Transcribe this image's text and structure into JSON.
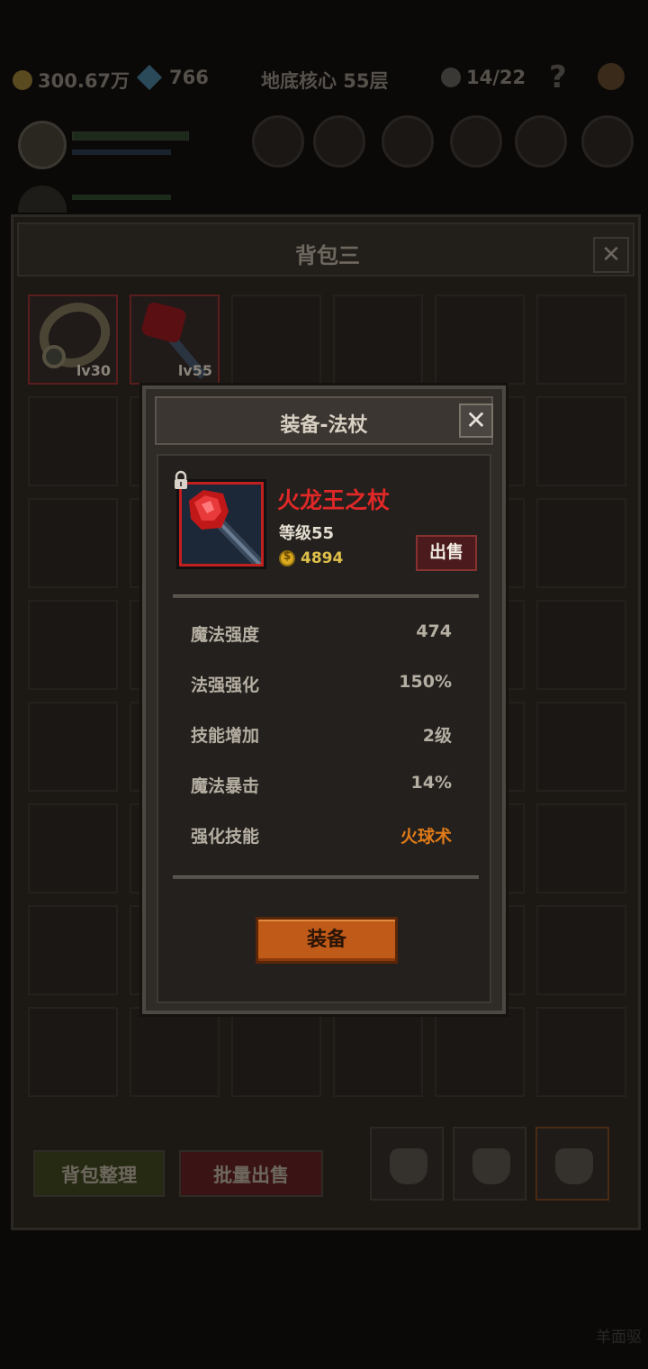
{
  "hud": {
    "gold": "300.67万",
    "gems": "766",
    "location": "地底核心 55层",
    "kills": "14/22",
    "help": "?"
  },
  "bag": {
    "title": "背包三",
    "close_label": "✕",
    "items": [
      {
        "name": "ring",
        "level": "lv30"
      },
      {
        "name": "fire-staff",
        "level": "lv55"
      }
    ],
    "sort_label": "背包整理",
    "batch_sell_label": "批量出售"
  },
  "dialog": {
    "title": "装备-法杖",
    "close_label": "✕",
    "item_name": "火龙王之杖",
    "item_level": "等级55",
    "price": "4894",
    "sell_label": "出售",
    "stats": [
      {
        "label": "魔法强度",
        "value": "474"
      },
      {
        "label": "法强强化",
        "value": "150%"
      },
      {
        "label": "技能增加",
        "value": "2级"
      },
      {
        "label": "魔法暴击",
        "value": "14%"
      },
      {
        "label": "强化技能",
        "value": "火球术"
      }
    ],
    "equip_label": "装备"
  },
  "watermark": "羊面驱",
  "colors": {
    "item_name": "#e02828",
    "skill_highlight": "#e07a18",
    "equip_button": "#c05a18",
    "sell_button": "#4a1a1c"
  }
}
